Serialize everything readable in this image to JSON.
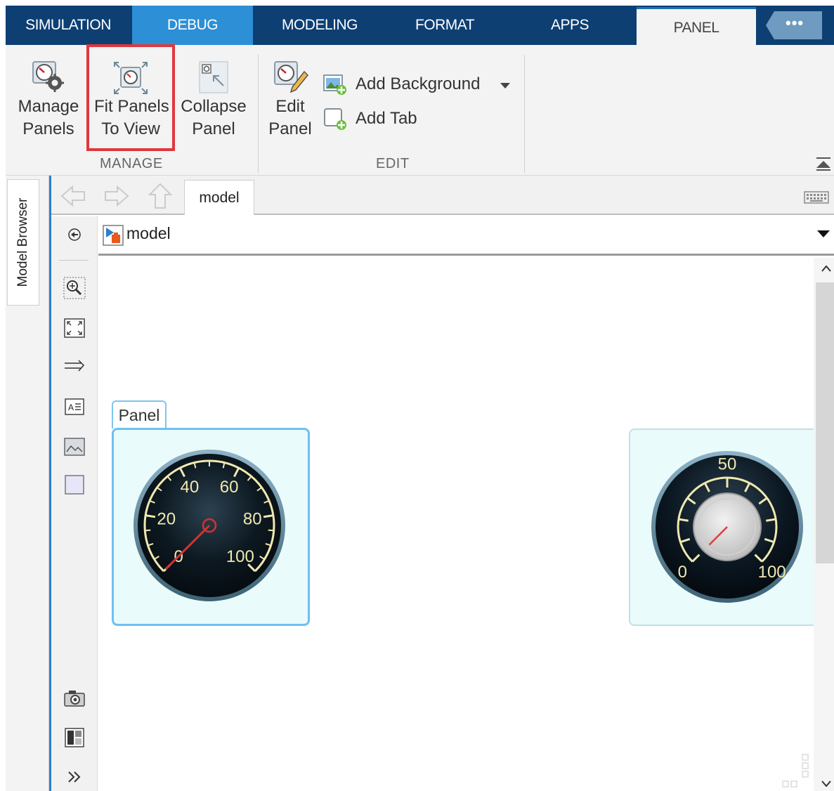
{
  "tabs": [
    {
      "label": "SIMULATION",
      "state": "normal"
    },
    {
      "label": "DEBUG",
      "state": "highlighted"
    },
    {
      "label": "MODELING",
      "state": "normal"
    },
    {
      "label": "FORMAT",
      "state": "normal"
    },
    {
      "label": "APPS",
      "state": "normal"
    },
    {
      "label": "PANEL",
      "state": "active"
    }
  ],
  "more_button_label": "•••",
  "ribbon": {
    "manage_group": {
      "label": "MANAGE",
      "buttons": {
        "manage_panels": {
          "line1": "Manage",
          "line2": "Panels"
        },
        "fit_panels": {
          "line1": "Fit Panels",
          "line2": "To View"
        },
        "collapse_panel": {
          "line1": "Collapse",
          "line2": "Panel"
        }
      }
    },
    "edit_group": {
      "label": "EDIT",
      "buttons": {
        "edit_panel": {
          "line1": "Edit",
          "line2": "Panel"
        },
        "add_background": "Add Background",
        "add_tab": "Add Tab"
      }
    }
  },
  "model_browser_label": "Model Browser",
  "editor": {
    "tab_label": "model",
    "address": "model"
  },
  "canvas": {
    "panel_tab_label": "Panel",
    "gauge": {
      "min": 0,
      "max": 100,
      "tick_labels": [
        "0",
        "20",
        "40",
        "60",
        "80",
        "100"
      ],
      "value": 0
    },
    "knob": {
      "min": 0,
      "max": 100,
      "tick_labels": [
        "0",
        "50",
        "100"
      ],
      "value": 0
    }
  },
  "colors": {
    "tab_bar": "#0d3f73",
    "tab_debug": "#2d8fd6",
    "ribbon": "#f3f3f3",
    "highlight": "#e0373d",
    "panel_border": "#6fc0f0",
    "panel_fill": "#e9fbfb",
    "gauge_scale": "#f0e8b0",
    "needle": "#e23030"
  }
}
